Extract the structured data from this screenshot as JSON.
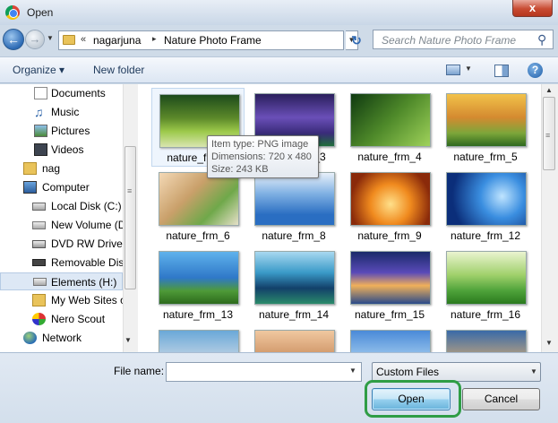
{
  "window": {
    "title": "Open",
    "close_glyph": "x"
  },
  "address": {
    "overflow": "«",
    "segments": [
      "nagarjuna",
      "Nature Photo Frame"
    ],
    "separator": "▸",
    "dropdown": "▼",
    "refresh": "↻"
  },
  "search": {
    "placeholder": "Search Nature Photo Frame",
    "icon": "search-icon"
  },
  "toolbar": {
    "organize": "Organize ▾",
    "new_folder": "New folder",
    "help": "?"
  },
  "nav": {
    "items": [
      {
        "label": "Documents",
        "icon": "documents-icon"
      },
      {
        "label": "Music",
        "icon": "music-icon"
      },
      {
        "label": "Pictures",
        "icon": "pictures-icon"
      },
      {
        "label": "Videos",
        "icon": "videos-icon"
      },
      {
        "label": "nag",
        "icon": "user-folder-icon"
      },
      {
        "label": "Computer",
        "icon": "computer-icon"
      },
      {
        "label": "Local Disk (C:)",
        "icon": "local-disk-icon"
      },
      {
        "label": "New Volume (D",
        "icon": "drive-icon"
      },
      {
        "label": "DVD RW Drive (",
        "icon": "dvd-drive-icon"
      },
      {
        "label": "Removable Dis",
        "icon": "removable-disk-icon"
      },
      {
        "label": "Elements (H:)",
        "icon": "drive-icon"
      },
      {
        "label": "My Web Sites o",
        "icon": "web-sites-icon"
      },
      {
        "label": "Nero Scout",
        "icon": "nero-scout-icon"
      },
      {
        "label": "Network",
        "icon": "network-icon"
      }
    ]
  },
  "files": [
    {
      "name": "nature_frm_1"
    },
    {
      "name": "nature_frm_3"
    },
    {
      "name": "nature_frm_4"
    },
    {
      "name": "nature_frm_5"
    },
    {
      "name": "nature_frm_6"
    },
    {
      "name": "nature_frm_8"
    },
    {
      "name": "nature_frm_9"
    },
    {
      "name": "nature_frm_12"
    },
    {
      "name": "nature_frm_13"
    },
    {
      "name": "nature_frm_14"
    },
    {
      "name": "nature_frm_15"
    },
    {
      "name": "nature_frm_16"
    },
    {
      "name": ""
    },
    {
      "name": ""
    },
    {
      "name": ""
    },
    {
      "name": ""
    }
  ],
  "tooltip": {
    "type": "Item type: PNG image",
    "dimensions": "Dimensions: 720 x 480",
    "size": "Size: 243 KB"
  },
  "footer": {
    "file_name_label": "File name:",
    "file_name_value": "",
    "filter": "Custom Files",
    "open": "Open",
    "cancel": "Cancel"
  }
}
